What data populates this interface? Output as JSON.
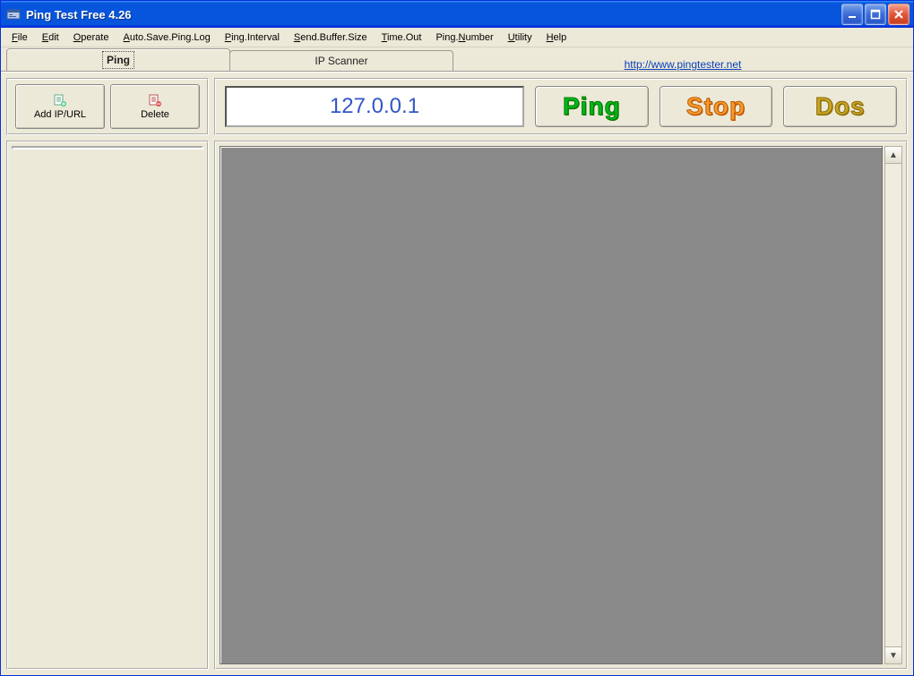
{
  "window": {
    "title": "Ping Test Free 4.26"
  },
  "menu": {
    "file": "File",
    "edit": "Edit",
    "operate": "Operate",
    "autosave": "Auto.Save.Ping.Log",
    "interval": "Ping.Interval",
    "sendbuf": "Send.Buffer.Size",
    "timeout": "Time.Out",
    "pingnum": "Ping.Number",
    "utility": "Utility",
    "help": "Help"
  },
  "tabs": {
    "ping": "Ping",
    "ipscanner": "IP Scanner",
    "link": "http://www.pingtester.net"
  },
  "left": {
    "add": "Add IP/URL",
    "delete": "Delete"
  },
  "main": {
    "ip": "127.0.0.1",
    "ping": "Ping",
    "stop": "Stop",
    "dos": "Dos"
  }
}
